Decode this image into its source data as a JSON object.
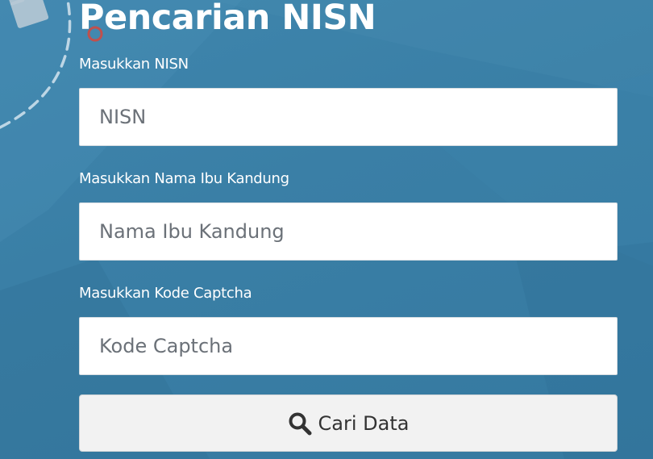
{
  "page": {
    "title": "Pencarian NISN"
  },
  "form": {
    "nisn": {
      "label": "Masukkan NISN",
      "placeholder": "NISN",
      "value": ""
    },
    "mother_name": {
      "label": "Masukkan Nama Ibu Kandung",
      "placeholder": "Nama Ibu Kandung",
      "value": ""
    },
    "captcha": {
      "label": "Masukkan Kode Captcha",
      "placeholder": "Kode Captcha",
      "value": ""
    },
    "submit": {
      "label": "Cari Data",
      "icon": "search-icon"
    }
  },
  "decoration": {
    "background_color": "#3a7fa6",
    "folder_icon": "folder-icon",
    "waypoint_color": "#c0504d"
  }
}
